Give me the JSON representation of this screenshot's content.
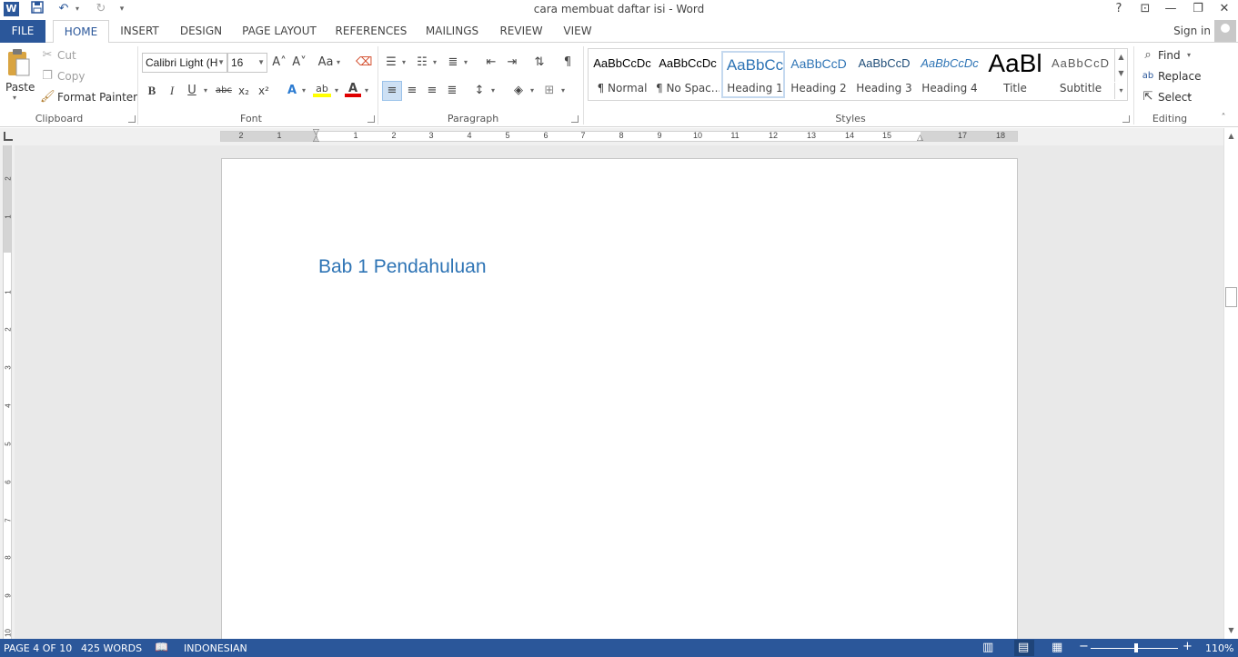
{
  "window": {
    "title": "cara membuat daftar isi - Word",
    "app_icon_letter": "W",
    "help": "?",
    "ribbon_display": "⊡",
    "minimize": "—",
    "restore": "❐",
    "close": "✕"
  },
  "quick_access": {
    "save": "💾",
    "undo": "↶",
    "redo": "↻",
    "customize": "▾"
  },
  "tabs": [
    "FILE",
    "HOME",
    "INSERT",
    "DESIGN",
    "PAGE LAYOUT",
    "REFERENCES",
    "MAILINGS",
    "REVIEW",
    "VIEW"
  ],
  "active_tab": "HOME",
  "account": {
    "sign_in": "Sign in"
  },
  "clipboard": {
    "label": "Clipboard",
    "paste": "Paste",
    "cut": "Cut",
    "copy": "Copy",
    "format_painter": "Format Painter"
  },
  "font": {
    "label": "Font",
    "name": "Calibri Light (H",
    "size": "16",
    "bold": "B",
    "italic": "I",
    "underline": "U",
    "strikethrough": "abc",
    "subscript": "x₂",
    "superscript": "x²",
    "grow": "A˄",
    "shrink": "A˅",
    "change_case": "Aa",
    "text_effects": "A",
    "highlight": "ab",
    "font_color": "A"
  },
  "paragraph": {
    "label": "Paragraph",
    "show_marks": "¶"
  },
  "styles": {
    "label": "Styles",
    "items": [
      {
        "sample": "AaBbCcDc",
        "name": "¶ Normal"
      },
      {
        "sample": "AaBbCcDc",
        "name": "¶ No Spac..."
      },
      {
        "sample": "AaBbCc",
        "name": "Heading 1"
      },
      {
        "sample": "AaBbCcD",
        "name": "Heading 2"
      },
      {
        "sample": "AaBbCcD",
        "name": "Heading 3"
      },
      {
        "sample": "AaBbCcDc",
        "name": "Heading 4"
      },
      {
        "sample": "AaBl",
        "name": "Title"
      },
      {
        "sample": "AaBbCcD",
        "name": "Subtitle"
      }
    ],
    "selected": "Heading 1"
  },
  "editing": {
    "label": "Editing",
    "find": "Find",
    "replace": "Replace",
    "select": "Select"
  },
  "ruler": {
    "numbers": [
      "2",
      "1",
      "1",
      "2",
      "3",
      "4",
      "5",
      "6",
      "7",
      "8",
      "9",
      "10",
      "11",
      "12",
      "13",
      "14",
      "15",
      "17",
      "18"
    ],
    "vertical_numbers": [
      "2",
      "1",
      "1",
      "2",
      "3",
      "4",
      "5",
      "6",
      "7",
      "8",
      "9",
      "10"
    ]
  },
  "document": {
    "heading": "Bab 1 Pendahuluan"
  },
  "status": {
    "page": "PAGE 4 OF 10",
    "words": "425 WORDS",
    "language": "INDONESIAN",
    "zoom": "110%",
    "zoom_minus": "−",
    "zoom_plus": "+"
  },
  "colors": {
    "accent": "#2b579a",
    "heading_text": "#2e74b5"
  }
}
